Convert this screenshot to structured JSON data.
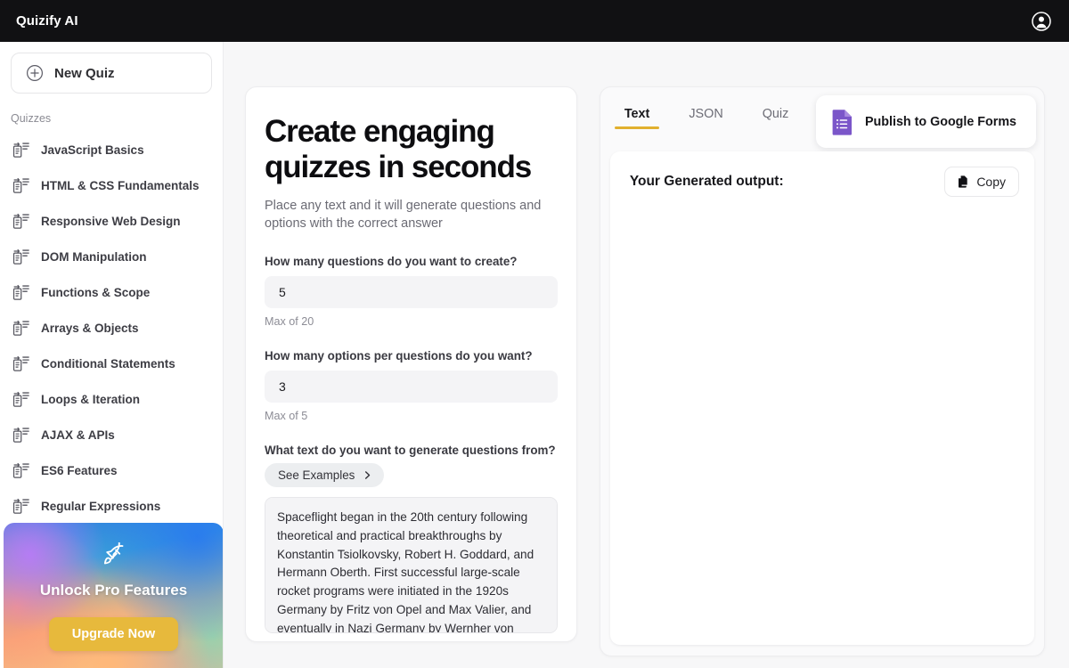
{
  "topbar": {
    "brand": "Quizify AI",
    "account_icon": "user-circle-icon"
  },
  "sidebar": {
    "new_quiz_label": "New Quiz",
    "new_quiz_icon": "plus-circle-icon",
    "section_label": "Quizzes",
    "item_icon": "quiz-document-icon",
    "items": [
      {
        "label": "JavaScript Basics"
      },
      {
        "label": "HTML & CSS Fundamentals"
      },
      {
        "label": "Responsive Web Design"
      },
      {
        "label": "DOM Manipulation"
      },
      {
        "label": "Functions & Scope"
      },
      {
        "label": "Arrays & Objects"
      },
      {
        "label": "Conditional Statements"
      },
      {
        "label": "Loops & Iteration"
      },
      {
        "label": "AJAX & APIs"
      },
      {
        "label": "ES6 Features"
      },
      {
        "label": "Regular Expressions"
      }
    ],
    "pro_card": {
      "icon": "rocket-icon",
      "title": "Unlock Pro Features",
      "button_label": "Upgrade Now",
      "button_color": "#e7b93c"
    }
  },
  "form": {
    "hero_title": "Create engaging quizzes in seconds",
    "hero_subtitle": "Place any text and it will generate questions and options with the correct answer",
    "questions_label": "How many questions do you want to create?",
    "questions_value": "5",
    "questions_hint": "Max of 20",
    "options_label": "How many options per questions do you want?",
    "options_value": "3",
    "options_hint": "Max of 5",
    "source_label": "What text do you want to generate questions from?",
    "examples_label": "See Examples",
    "examples_icon": "chevron-right-icon",
    "source_text": "Spaceflight began in the 20th century following theoretical and practical breakthroughs by Konstantin Tsiolkovsky, Robert H. Goddard, and Hermann Oberth. First successful large-scale rocket programs were initiated in the 1920s Germany by Fritz von Opel and Max Valier, and eventually in Nazi Germany by Wernher von Braun."
  },
  "output": {
    "tabs": [
      {
        "label": "Text",
        "active": true
      },
      {
        "label": "JSON",
        "active": false
      },
      {
        "label": "Quiz",
        "active": false
      }
    ],
    "active_tab_color": "#e1b02e",
    "publish_label": "Publish to Google Forms",
    "publish_icon": "google-forms-icon",
    "generated_title": "Your Generated output:",
    "copy_label": "Copy",
    "copy_icon": "copy-icon",
    "generated_text": ""
  }
}
